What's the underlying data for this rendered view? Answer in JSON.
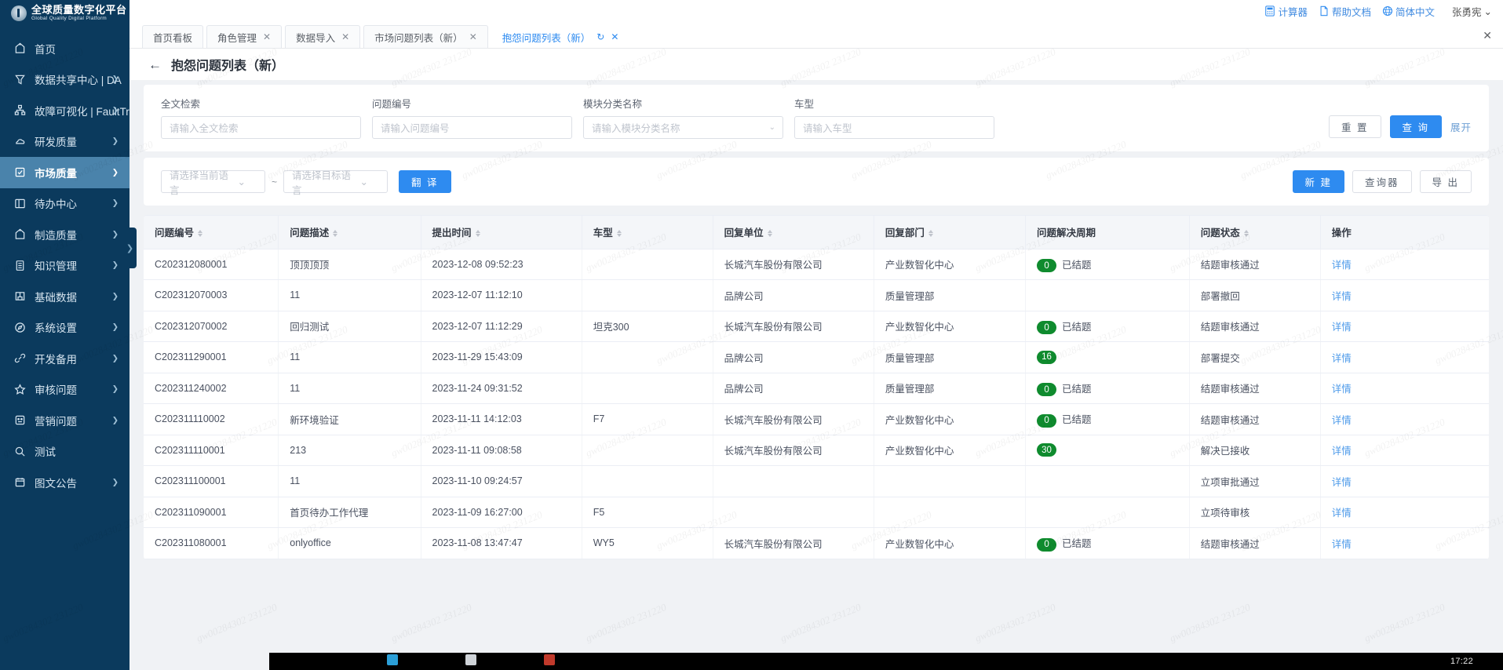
{
  "brand": {
    "name_cn": "全球质量数字化平台",
    "name_en": "Global Quality Digital Platform",
    "logo_icon": "circle-logo-icon"
  },
  "topbar": {
    "items": [
      {
        "label": "计算器",
        "icon": "calculator-icon"
      },
      {
        "label": "帮助文档",
        "icon": "document-icon"
      },
      {
        "label": "简体中文",
        "icon": "globe-icon"
      }
    ],
    "user": {
      "name": "张勇宪",
      "caret": "⌄"
    }
  },
  "sidebar": {
    "items": [
      {
        "label": "首页",
        "icon": "home-icon",
        "arrow": false,
        "active": false
      },
      {
        "label": "数据共享中心 | DA",
        "icon": "funnel-icon",
        "arrow": true,
        "active": false
      },
      {
        "label": "故障可视化 | FaultTree",
        "icon": "sitemap-icon",
        "arrow": true,
        "active": false
      },
      {
        "label": "研发质量",
        "icon": "cloud-icon",
        "arrow": true,
        "active": false
      },
      {
        "label": "市场质量",
        "icon": "checkbox-icon",
        "arrow": true,
        "active": true
      },
      {
        "label": "待办中心",
        "icon": "layout-icon",
        "arrow": true,
        "active": false
      },
      {
        "label": "制造质量",
        "icon": "home-icon",
        "arrow": true,
        "active": false
      },
      {
        "label": "知识管理",
        "icon": "book-icon",
        "arrow": true,
        "active": false
      },
      {
        "label": "基础数据",
        "icon": "grid-icon",
        "arrow": true,
        "active": false
      },
      {
        "label": "系统设置",
        "icon": "compass-icon",
        "arrow": true,
        "active": false
      },
      {
        "label": "开发备用",
        "icon": "link-icon",
        "arrow": true,
        "active": false
      },
      {
        "label": "审核问题",
        "icon": "star-icon",
        "arrow": true,
        "active": false
      },
      {
        "label": "营销问题",
        "icon": "face-icon",
        "arrow": true,
        "active": false
      },
      {
        "label": "测试",
        "icon": "search-icon",
        "arrow": false,
        "active": false
      },
      {
        "label": "图文公告",
        "icon": "calendar-icon",
        "arrow": true,
        "active": false
      }
    ],
    "collapse_icon": "chevron-right-icon"
  },
  "tabs": {
    "items": [
      {
        "label": "首页看板",
        "closable": false,
        "active": false,
        "refresh": false
      },
      {
        "label": "角色管理",
        "closable": true,
        "active": false,
        "refresh": false
      },
      {
        "label": "数据导入",
        "closable": true,
        "active": false,
        "refresh": false
      },
      {
        "label": "市场问题列表（新）",
        "closable": true,
        "active": false,
        "refresh": false
      },
      {
        "label": "抱怨问题列表（新）",
        "closable": true,
        "active": true,
        "refresh": true
      }
    ],
    "close_all_icon": "close-icon",
    "close_glyph": "✕",
    "refresh_glyph": "↻"
  },
  "page": {
    "back_glyph": "←",
    "title": "抱怨问题列表（新）"
  },
  "filters": {
    "fields": [
      {
        "label": "全文检索",
        "placeholder": "请输入全文检索",
        "value": "",
        "type": "text"
      },
      {
        "label": "问题编号",
        "placeholder": "请输入问题编号",
        "value": "",
        "type": "text"
      },
      {
        "label": "模块分类名称",
        "placeholder": "请输入模块分类名称",
        "value": "",
        "type": "select"
      },
      {
        "label": "车型",
        "placeholder": "请输入车型",
        "value": "",
        "type": "text"
      }
    ],
    "reset_label": "重 置",
    "query_label": "查 询",
    "expand_label": "展开"
  },
  "toolbar": {
    "source_lang_placeholder": "请选择当前语言",
    "separator": "~",
    "target_lang_placeholder": "请选择目标语言",
    "translate_label": "翻 译",
    "new_label": "新 建",
    "query_builder_label": "查询器",
    "export_label": "导 出"
  },
  "table": {
    "columns": [
      {
        "label": "问题编号",
        "sortable": true
      },
      {
        "label": "问题描述",
        "sortable": true
      },
      {
        "label": "提出时间",
        "sortable": true
      },
      {
        "label": "车型",
        "sortable": true
      },
      {
        "label": "回复单位",
        "sortable": true
      },
      {
        "label": "回复部门",
        "sortable": true
      },
      {
        "label": "问题解决周期",
        "sortable": false
      },
      {
        "label": "问题状态",
        "sortable": true
      },
      {
        "label": "操作",
        "sortable": false
      }
    ],
    "action_label": "详情",
    "rows": [
      {
        "id": "C202312080001",
        "desc": "顶顶顶顶",
        "time": "2023-12-08 09:52:23",
        "model": "",
        "unit": "长城汽车股份有限公司",
        "dept": "产业数智化中心",
        "cycle": "0",
        "cycle_text": "已结题",
        "status": "结题审核通过"
      },
      {
        "id": "C202312070003",
        "desc": "11",
        "time": "2023-12-07 11:12:10",
        "model": "",
        "unit": "品牌公司",
        "dept": "质量管理部",
        "cycle": "",
        "cycle_text": "",
        "status": "部署撤回"
      },
      {
        "id": "C202312070002",
        "desc": "回归测试",
        "time": "2023-12-07 11:12:29",
        "model": "坦克300",
        "unit": "长城汽车股份有限公司",
        "dept": "产业数智化中心",
        "cycle": "0",
        "cycle_text": "已结题",
        "status": "结题审核通过"
      },
      {
        "id": "C202311290001",
        "desc": "11",
        "time": "2023-11-29 15:43:09",
        "model": "",
        "unit": "品牌公司",
        "dept": "质量管理部",
        "cycle": "16",
        "cycle_text": "",
        "status": "部署提交"
      },
      {
        "id": "C202311240002",
        "desc": "11",
        "time": "2023-11-24 09:31:52",
        "model": "",
        "unit": "品牌公司",
        "dept": "质量管理部",
        "cycle": "0",
        "cycle_text": "已结题",
        "status": "结题审核通过"
      },
      {
        "id": "C202311110002",
        "desc": "新环境验证",
        "time": "2023-11-11 14:12:03",
        "model": "F7",
        "unit": "长城汽车股份有限公司",
        "dept": "产业数智化中心",
        "cycle": "0",
        "cycle_text": "已结题",
        "status": "结题审核通过"
      },
      {
        "id": "C202311110001",
        "desc": "213",
        "time": "2023-11-11 09:08:58",
        "model": "",
        "unit": "长城汽车股份有限公司",
        "dept": "产业数智化中心",
        "cycle": "30",
        "cycle_text": "",
        "status": "解决已接收"
      },
      {
        "id": "C202311100001",
        "desc": "11",
        "time": "2023-11-10 09:24:57",
        "model": "",
        "unit": "",
        "dept": "",
        "cycle": "",
        "cycle_text": "",
        "status": "立项审批通过"
      },
      {
        "id": "C202311090001",
        "desc": "首页待办工作代理",
        "time": "2023-11-09 16:27:00",
        "model": "F5",
        "unit": "",
        "dept": "",
        "cycle": "",
        "cycle_text": "",
        "status": "立项待审核"
      },
      {
        "id": "C202311080001",
        "desc": "onlyoffice",
        "time": "2023-11-08 13:47:47",
        "model": "WY5",
        "unit": "长城汽车股份有限公司",
        "dept": "产业数智化中心",
        "cycle": "0",
        "cycle_text": "已结题",
        "status": "结题审核通过"
      }
    ]
  },
  "taskbar": {
    "clock": "17:22"
  },
  "watermark": {
    "text": "gw00284302 231220"
  },
  "colors": {
    "sidebar_bg": "#0b3a5d",
    "sidebar_active": "#4a83ab",
    "primary": "#2e8bf0",
    "pill_green": "#0f8b2e",
    "link": "#4e9bea"
  }
}
